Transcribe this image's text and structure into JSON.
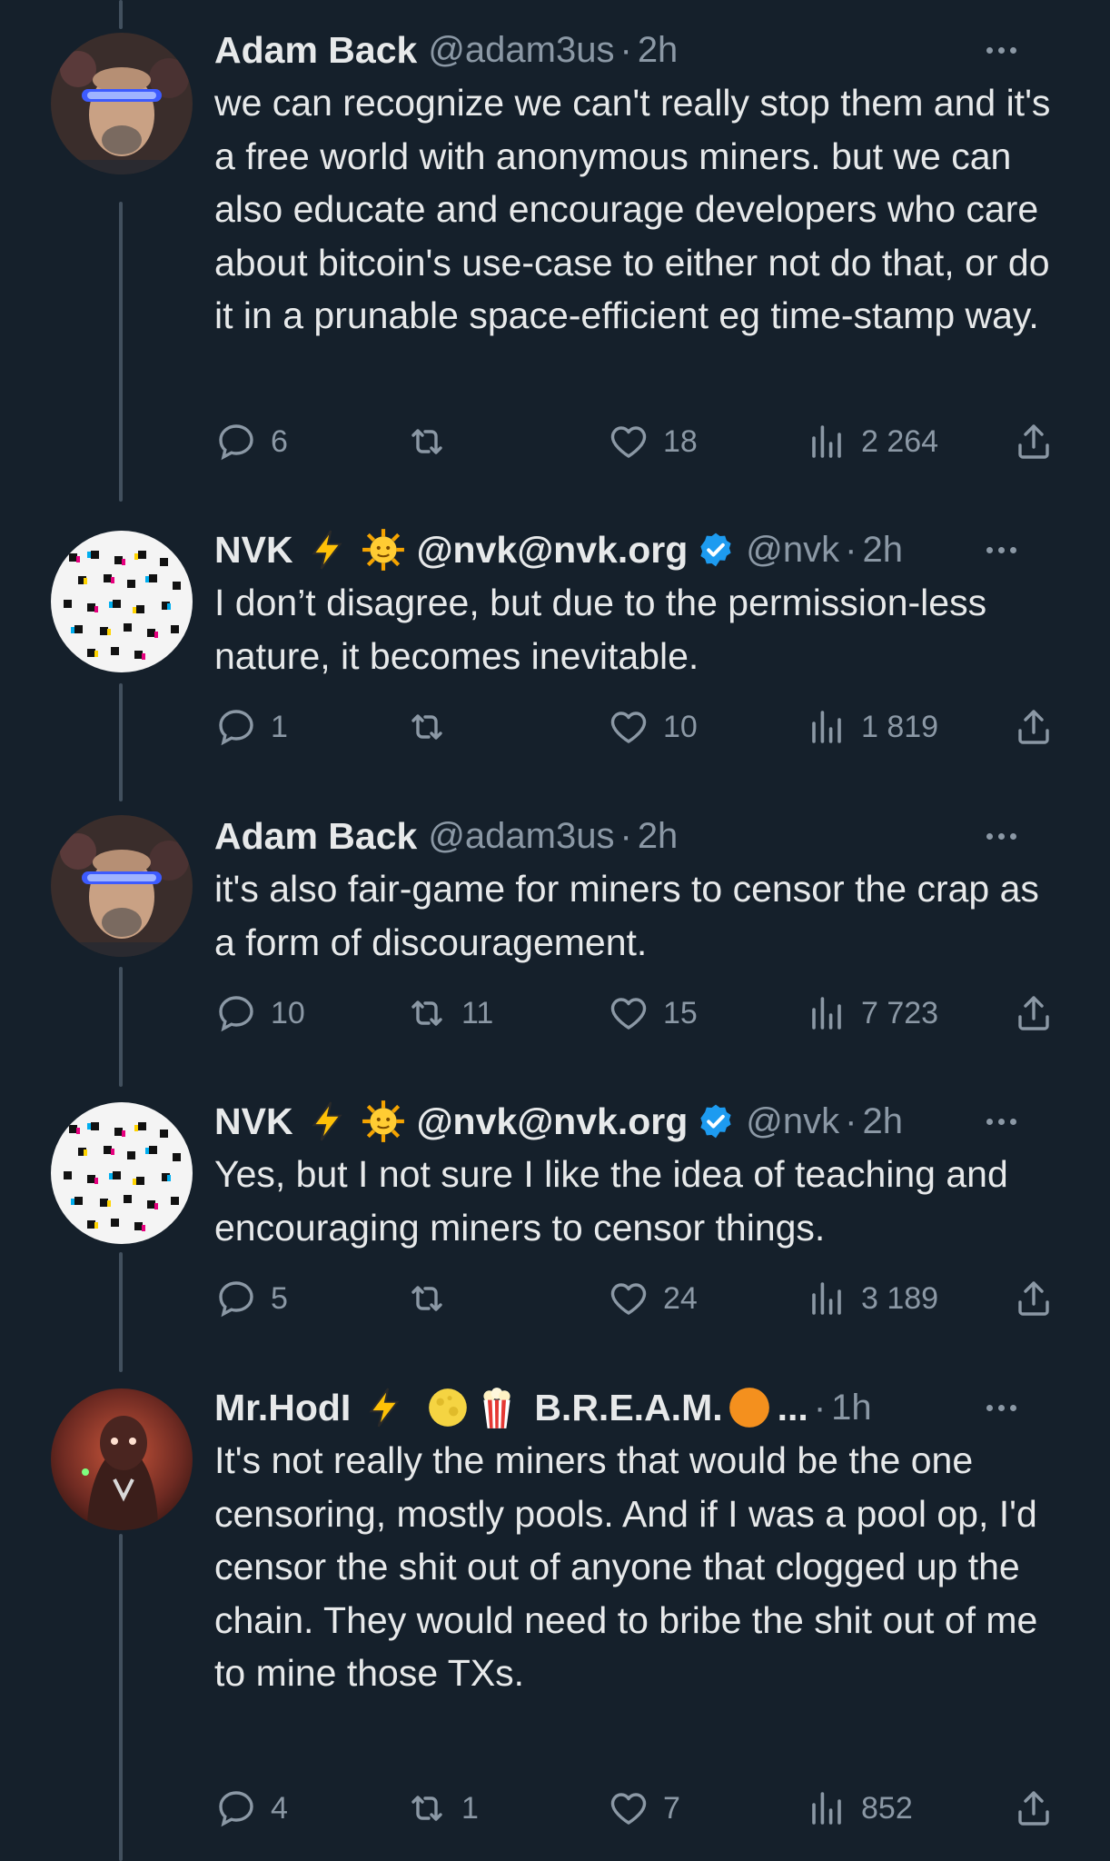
{
  "tweets": [
    {
      "name": "Adam Back",
      "handle": "@adam3us",
      "sep": "·",
      "time": "2h",
      "text": "we can recognize we can't really stop them and it's a free world with anonymous miners. but we can also educate and encourage developers who care about bitcoin's use-case to either not do that, or do it in a prunable space-efficient eg time-stamp way.",
      "replies": "6",
      "retweets": "",
      "likes": "18",
      "views": "2 264"
    },
    {
      "name": "NVK",
      "name_suffix": "@nvk@nvk.org",
      "handle": "@nvk",
      "sep": "·",
      "time": "2h",
      "text": "I don’t disagree, but due to the permission-less nature, it becomes inevitable.",
      "replies": "1",
      "retweets": "",
      "likes": "10",
      "views": "1 819"
    },
    {
      "name": "Adam Back",
      "handle": "@adam3us",
      "sep": "·",
      "time": "2h",
      "text": "it's also fair-game for miners to censor the crap as a form of discouragement.",
      "replies": "10",
      "retweets": "11",
      "likes": "15",
      "views": "7 723"
    },
    {
      "name": "NVK",
      "name_suffix": "@nvk@nvk.org",
      "handle": "@nvk",
      "sep": "·",
      "time": "2h",
      "text": "Yes, but I not sure I like the idea of teaching and encouraging miners to censor things.",
      "replies": "5",
      "retweets": "",
      "likes": "24",
      "views": "3 189"
    },
    {
      "name": "Mr.HodI",
      "name_suffix": "B.R.E.A.M.",
      "truncation": "...",
      "sep": "·",
      "time": "1h",
      "text": "It's not really the miners that would be the one censoring, mostly pools. And if I was a pool op, I'd censor the shit out of anyone that clogged up the chain. They would need to bribe the shit out of me to mine those TXs.",
      "replies": "4",
      "retweets": "1",
      "likes": "7",
      "views": "852"
    }
  ],
  "icons": {
    "reply": "reply-icon",
    "retweet": "retweet-icon",
    "like": "heart-icon",
    "views": "views-icon",
    "share": "share-icon",
    "more": "more-icon",
    "verified": "verified-badge-icon",
    "lightning": "lightning-emoji",
    "sun": "sun-face-emoji",
    "moon": "full-moon-emoji",
    "popcorn": "popcorn-emoji",
    "orange_circle": "orange-circle-emoji"
  },
  "colors": {
    "background": "#15202b",
    "text": "#e7e9ea",
    "muted": "#8b98a5",
    "verified": "#1d9bf0",
    "thread_line": "#42505e"
  }
}
